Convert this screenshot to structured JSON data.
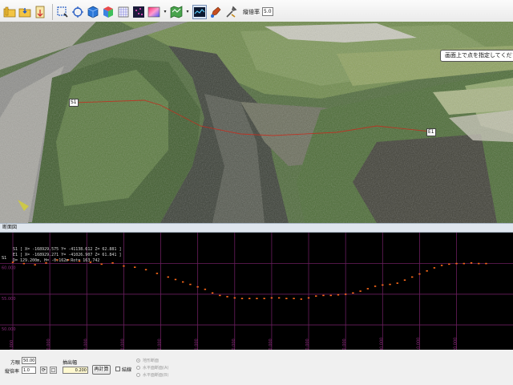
{
  "toolbar": {
    "buttons": [
      {
        "name": "open-folder-button",
        "icon": "folder-icon"
      },
      {
        "name": "save-folder-button",
        "icon": "folder-arrow-icon"
      },
      {
        "name": "export-button",
        "icon": "save-file-icon"
      },
      {
        "name": "zoom-window-button",
        "icon": "zoom-window-icon"
      },
      {
        "name": "rotate-view-button",
        "icon": "rotate-view-icon"
      },
      {
        "name": "cube-view-button",
        "icon": "blue-cube-icon"
      },
      {
        "name": "color-cube-button",
        "icon": "color-cube-icon"
      },
      {
        "name": "grid-button",
        "icon": "grid-icon"
      },
      {
        "name": "point-display-button",
        "icon": "point-display-icon"
      },
      {
        "name": "color-scale-button",
        "icon": "color-scale-icon"
      },
      {
        "name": "map-view-button",
        "icon": "map-view-icon"
      },
      {
        "name": "profile-button",
        "icon": "profile-icon"
      },
      {
        "name": "paint-button",
        "icon": "paint-icon"
      },
      {
        "name": "tools-button",
        "icon": "tools-icon"
      }
    ],
    "zoom_label": "縦倍率",
    "zoom_value": "5.0"
  },
  "view": {
    "tooltip": "画面上で点を指定してください",
    "start_label": "S1",
    "end_label": "E1"
  },
  "profile": {
    "header": "断面図",
    "info_lines": [
      "S1 [ X= -168929.575  Y= -41138.612  Z= 62.881 ]",
      "E1 [ X= -168929.271  Y= -41026.907  Z= 61.841 ]",
      "D= 129.200m,  H= -0.162m  Rot= 163.742"
    ],
    "start_marker": "S1",
    "y_tick_labels": [
      "60.000",
      "55.000",
      "50.000"
    ],
    "x_tick_labels": [
      "0.000",
      "10.000",
      "20.000",
      "30.000",
      "40.000",
      "50.000",
      "60.000",
      "70.000",
      "80.000",
      "90.000",
      "100.000",
      "110.000",
      "120.000"
    ]
  },
  "chart_data": {
    "type": "scatter",
    "title": "",
    "xlabel": "",
    "ylabel": "",
    "xlim": [
      0,
      129.2
    ],
    "ylim": [
      47,
      64
    ],
    "x_ticks": [
      0,
      10,
      20,
      30,
      40,
      50,
      60,
      70,
      80,
      90,
      100,
      110,
      120
    ],
    "y_ticks": [
      60,
      55,
      50
    ],
    "grid": true,
    "series": [
      {
        "color": "#ff6a1a",
        "x": [
          0,
          3,
          6,
          9,
          12,
          15,
          18,
          21,
          24,
          27,
          30,
          33,
          36,
          39,
          42,
          44,
          46,
          48,
          50,
          52,
          54,
          56,
          58,
          60,
          62,
          64,
          66,
          68,
          70,
          72,
          74,
          76,
          78,
          80,
          82,
          84,
          86,
          88,
          90,
          92,
          94,
          96,
          98,
          100,
          102,
          104,
          106,
          108,
          110,
          112,
          114,
          116,
          118,
          120,
          122,
          124,
          126,
          128
        ],
        "y": [
          60.2,
          60.0,
          59.8,
          60.1,
          60.6,
          60.6,
          60.4,
          60.2,
          59.9,
          60.1,
          59.6,
          59.4,
          59.0,
          58.4,
          57.8,
          57.4,
          57.0,
          56.6,
          56.2,
          55.8,
          55.2,
          54.8,
          54.6,
          54.4,
          54.3,
          54.3,
          54.3,
          54.3,
          54.4,
          54.4,
          54.3,
          54.3,
          54.2,
          54.4,
          54.7,
          54.8,
          54.8,
          54.9,
          55.0,
          55.2,
          55.5,
          55.9,
          56.3,
          56.5,
          56.6,
          56.8,
          57.3,
          57.8,
          58.3,
          58.8,
          59.3,
          59.7,
          59.9,
          60.0,
          60.0,
          60.1,
          60.0,
          60.0
        ]
      }
    ]
  },
  "controls": {
    "direction_label": "方眼",
    "direction_value": "50.00",
    "zoom_label": "縦倍率",
    "zoom_value": "1.0",
    "extract_width_label": "抽出幅",
    "extract_width_value": "0.200",
    "recalc_label": "再計算",
    "line_checkbox_label": "結線",
    "radio_options": [
      "地形断面",
      "水平面断面(A)",
      "水平面断面(B)"
    ]
  }
}
